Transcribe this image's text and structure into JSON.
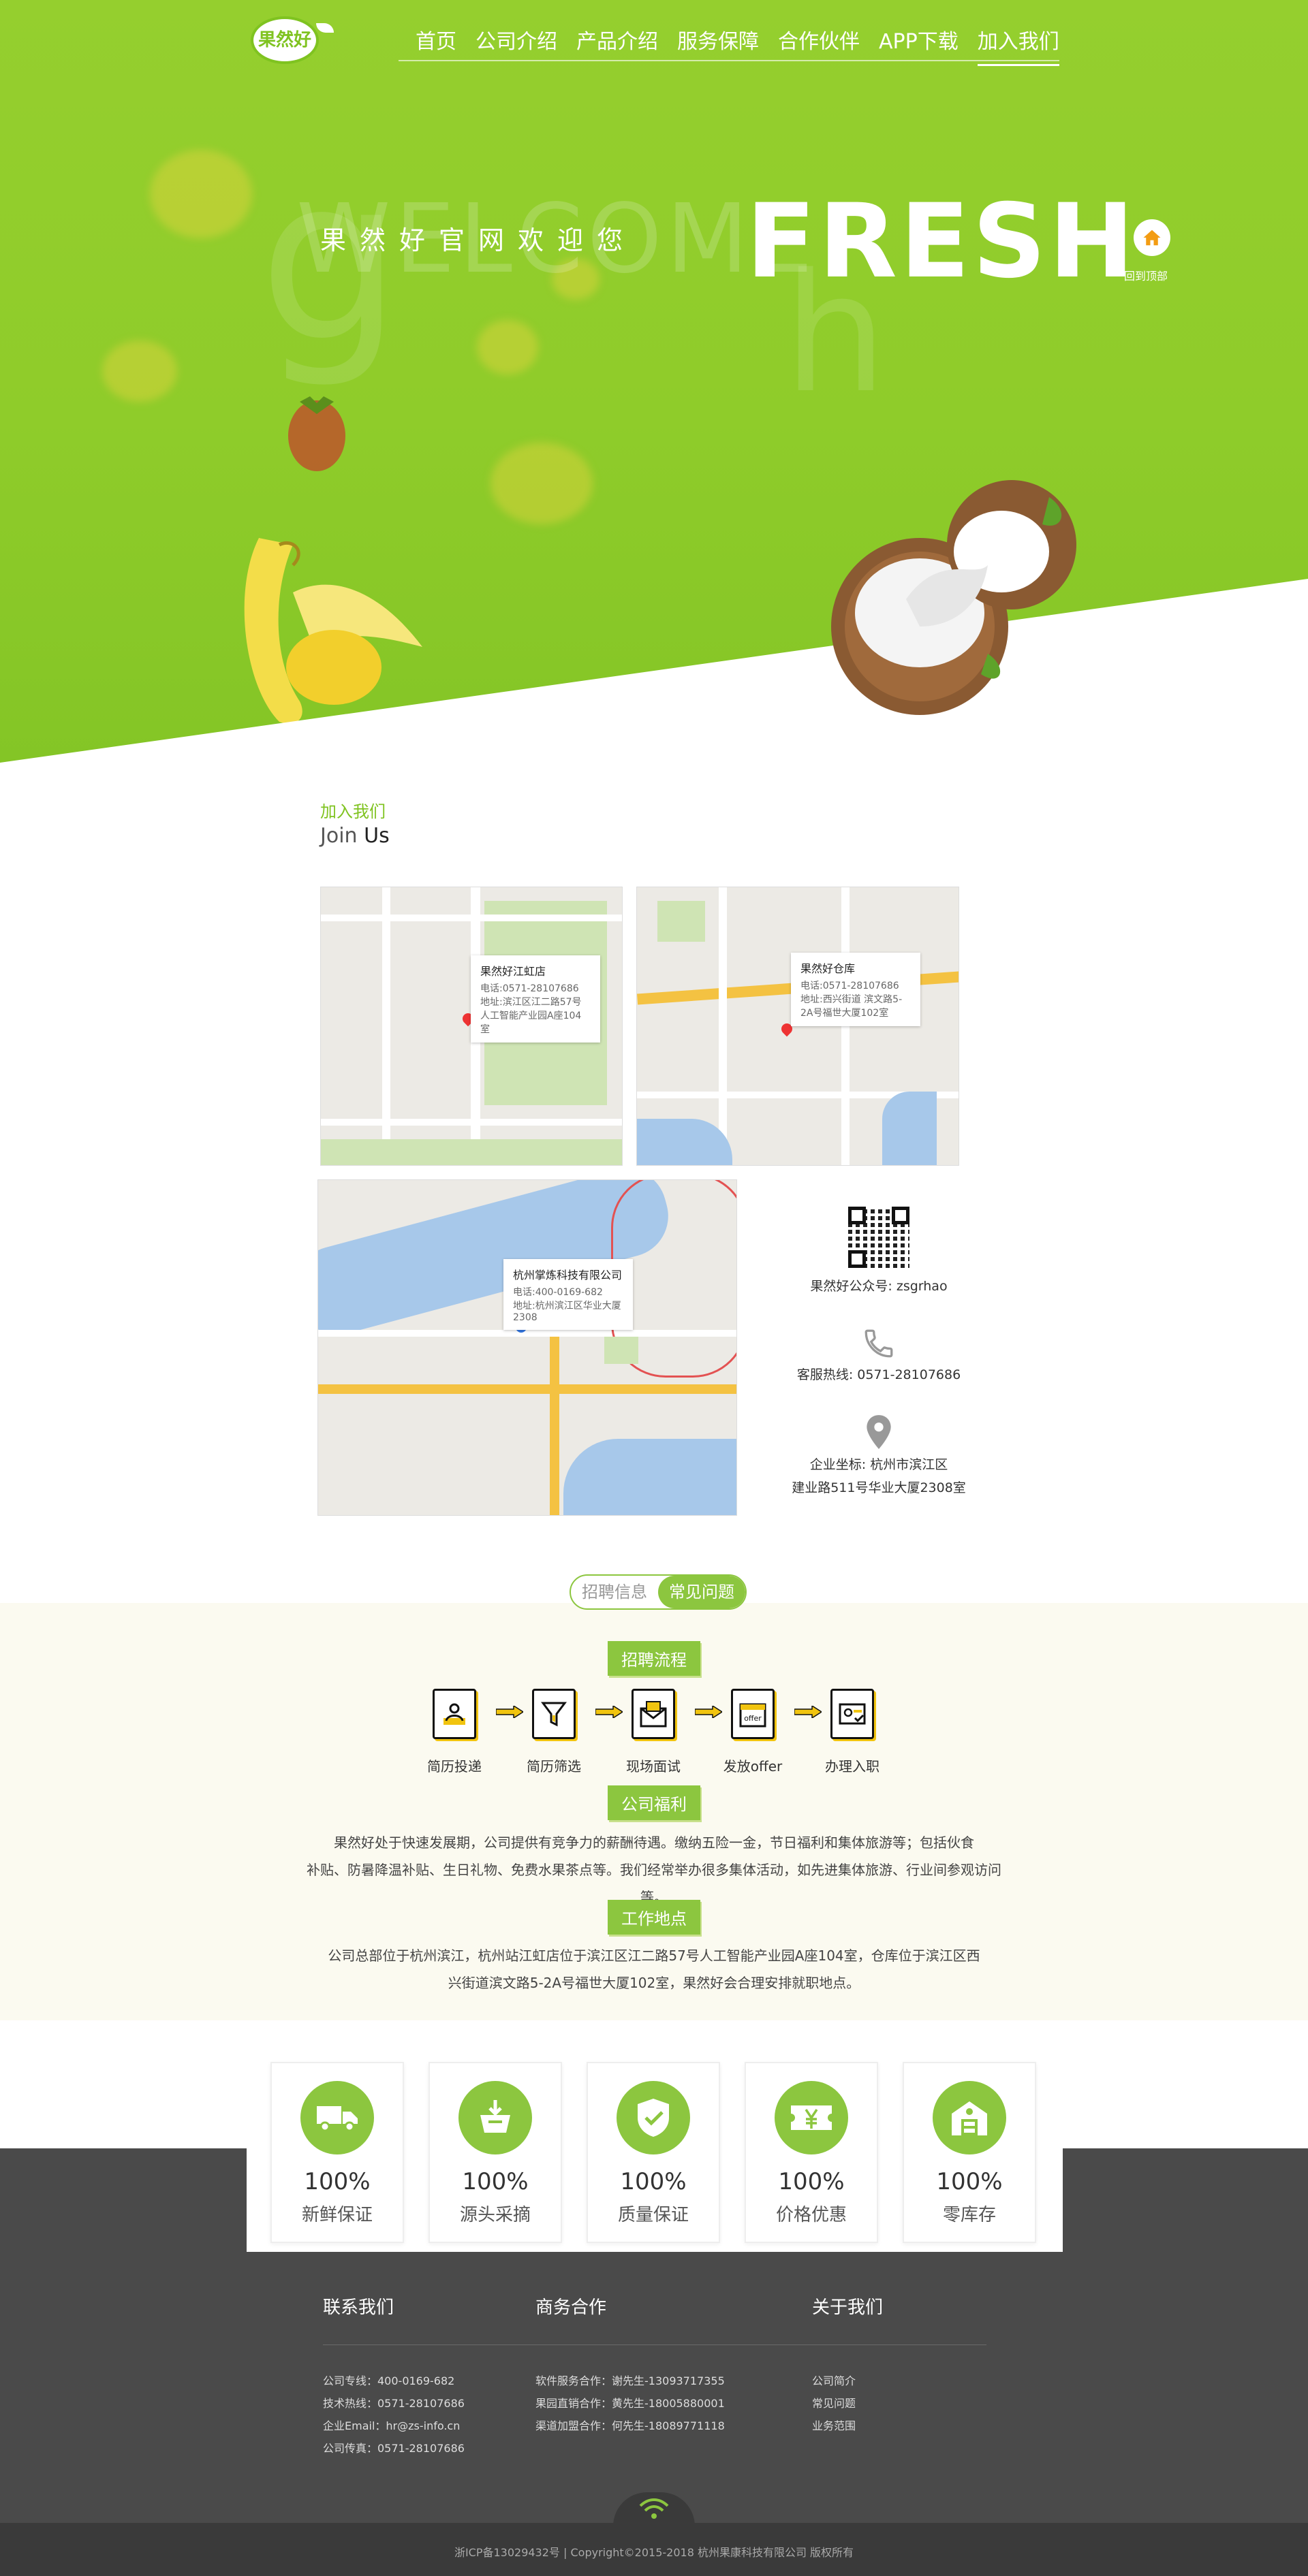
{
  "nav": {
    "logo_text": "果然好",
    "items": [
      "首页",
      "公司介绍",
      "产品介绍",
      "服务保障",
      "合作伙伴",
      "APP下载",
      "加入我们"
    ],
    "active_index": 6
  },
  "hero": {
    "ghost_text": "WELCOME",
    "tagline": "果然好官网欢迎您",
    "headline": "FRESH",
    "home_label": "回到顶部"
  },
  "join": {
    "title_cn": "加入我们",
    "title_en_1": "Join",
    "title_en_2": "Us"
  },
  "maps": [
    {
      "name": "果然好江虹店",
      "phone": "电话:0571-28107686",
      "addr": "地址:滨江区江二路57号人工智能产业园A座104室"
    },
    {
      "name": "果然好仓库",
      "phone": "电话:0571-28107686",
      "addr": "地址:西兴街道 滨文路5-2A号福世大厦102室"
    },
    {
      "name": "杭州掌炼科技有限公司",
      "phone": "电话:400-0169-682",
      "addr": "地址:杭州滨江区华业大厦2308"
    }
  ],
  "contact": {
    "wechat": "果然好公众号: zsgrhao",
    "hotline": "客服热线: 0571-28107686",
    "address_line1": "企业坐标: 杭州市滨江区",
    "address_line2": "建业路511号华业大厦2308室"
  },
  "tabs": [
    "招聘信息",
    "常见问题"
  ],
  "tab_active": 1,
  "recruit": {
    "process_title": "招聘流程",
    "steps": [
      "简历投递",
      "简历筛选",
      "现场面试",
      "发放offer",
      "办理入职"
    ],
    "offer_icon_text": "offer",
    "welfare_title": "公司福利",
    "welfare_line1": "果然好处于快速发展期，公司提供有竞争力的薪酬待遇。缴纳五险一金，节日福利和集体旅游等；包括伙食",
    "welfare_line2": "补贴、防暑降温补贴、生日礼物、免费水果茶点等。我们经常举办很多集体活动，如先进集体旅游、行业间参观访问等。",
    "location_title": "工作地点",
    "location_line1": "公司总部位于杭州滨江，杭州站江虹店位于滨江区江二路57号人工智能产业园A座104室，仓库位于滨江区西",
    "location_line2": "兴街道滨文路5-2A号福世大厦102室，果然好会合理安排就职地点。"
  },
  "features": [
    {
      "pct": "100%",
      "label": "新鲜保证",
      "icon": "truck-icon"
    },
    {
      "pct": "100%",
      "label": "源头采摘",
      "icon": "basket-icon"
    },
    {
      "pct": "100%",
      "label": "质量保证",
      "icon": "shield-check-icon"
    },
    {
      "pct": "100%",
      "label": "价格优惠",
      "icon": "yen-ticket-icon"
    },
    {
      "pct": "100%",
      "label": "零库存",
      "icon": "warehouse-icon"
    }
  ],
  "footer": {
    "col1_title": "联系我们",
    "col1": [
      "公司专线：400-0169-682",
      "技术热线：0571-28107686",
      "企业Email：hr@zs-info.cn",
      "公司传真：0571-28107686"
    ],
    "col2_title": "商务合作",
    "col2": [
      "软件服务合作：谢先生-13093717355",
      "果园直销合作：黄先生-18005880001",
      "渠道加盟合作：何先生-18089771118"
    ],
    "col3_title": "关于我们",
    "col3": [
      "公司简介",
      "常见问题",
      "业务范围"
    ],
    "copyright": "浙ICP备13029432号 | Copyright©2015-2018 杭州果康科技有限公司 版权所有"
  },
  "colors": {
    "brand_green": "#8cc63f",
    "footer_bg": "#4a4a4a",
    "accent_yellow": "#f1c40f"
  }
}
